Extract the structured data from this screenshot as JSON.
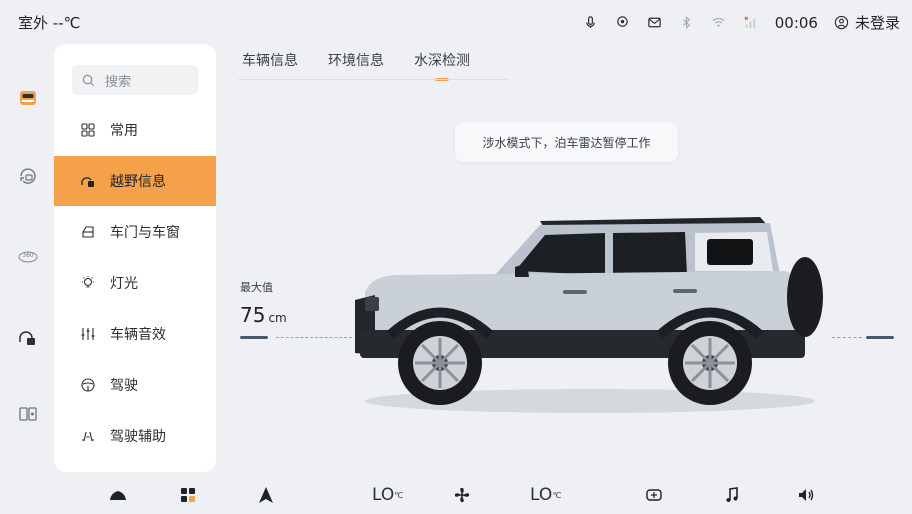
{
  "status_bar": {
    "outside_temp": "室外 --℃",
    "time": "00:06",
    "login_status": "未登录",
    "icons": [
      "mic-icon",
      "location-icon",
      "message-icon",
      "bluetooth-icon",
      "wifi-icon",
      "signal-icon",
      "user-icon"
    ]
  },
  "rail": {
    "items": [
      "vehicle-icon",
      "offroad-refresh-icon",
      "camera-360-icon",
      "offroad-lock-icon",
      "screen-mirror-icon"
    ],
    "camera_360_label": "360"
  },
  "menu": {
    "search_placeholder": "搜索",
    "items": [
      {
        "label": "常用",
        "icon": "grid-icon"
      },
      {
        "label": "越野信息",
        "icon": "offroad-icon"
      },
      {
        "label": "车门与车窗",
        "icon": "door-icon"
      },
      {
        "label": "灯光",
        "icon": "light-icon"
      },
      {
        "label": "车辆音效",
        "icon": "equalizer-icon"
      },
      {
        "label": "驾驶",
        "icon": "steering-wheel-icon"
      },
      {
        "label": "驾驶辅助",
        "icon": "driving-assist-icon"
      }
    ],
    "active_index": 1
  },
  "tabs": {
    "items": [
      "车辆信息",
      "环境信息",
      "水深检测"
    ],
    "active_index": 2
  },
  "toast": {
    "message": "涉水模式下，泊车雷达暂停工作"
  },
  "water_depth": {
    "label": "最大值",
    "value": "75",
    "unit": "cm"
  },
  "dock": {
    "left_temp": "LO",
    "right_temp": "LO",
    "temp_unit": "℃",
    "icons": [
      "car-home-icon",
      "apps-icon",
      "navigation-icon",
      "fan-icon",
      "camera-icon",
      "music-icon",
      "volume-icon"
    ]
  },
  "colors": {
    "accent": "#f5a14a",
    "background": "#eef0f3",
    "panel": "#ffffff"
  }
}
